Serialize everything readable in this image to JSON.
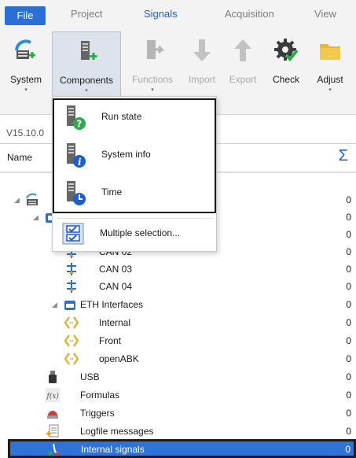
{
  "ribbon_tabs": [
    {
      "label": "File"
    },
    {
      "label": "Project"
    },
    {
      "label": "Signals"
    },
    {
      "label": "Acquisition"
    },
    {
      "label": "View"
    }
  ],
  "ribbon_buttons": [
    {
      "label": "System",
      "icon": "system-icon",
      "enabled": true
    },
    {
      "label": "Components",
      "icon": "components-icon",
      "enabled": true
    },
    {
      "label": "Functions",
      "icon": "functions-icon",
      "enabled": false
    },
    {
      "label": "Import",
      "icon": "import-arrow-icon",
      "enabled": false
    },
    {
      "label": "Export",
      "icon": "export-arrow-icon",
      "enabled": false
    },
    {
      "label": "Check",
      "icon": "check-gear-icon",
      "enabled": true
    },
    {
      "label": "Adjust",
      "icon": "folder-icon",
      "enabled": true
    }
  ],
  "dropdown_marker": "▾",
  "version": "V15.10.0",
  "table_header": {
    "name": "Name",
    "sum_symbol": "Σ"
  },
  "components_menu": {
    "items": [
      {
        "label": "Run state",
        "icon": "run-state-icon"
      },
      {
        "label": "System info",
        "icon": "system-info-icon"
      },
      {
        "label": "Time",
        "icon": "time-icon"
      },
      {
        "label": "Multiple selection...",
        "icon": "multiple-selection-icon"
      }
    ]
  },
  "tree": {
    "rows": [
      {
        "label": "",
        "value": "0",
        "icon": "system-icon"
      },
      {
        "label": "",
        "value": "0",
        "icon": "can-interfaces-icon"
      },
      {
        "label": "",
        "value": "0",
        "icon": "can-icon"
      },
      {
        "label": "CAN 02",
        "value": "0",
        "icon": "can-icon"
      },
      {
        "label": "CAN 03",
        "value": "0",
        "icon": "can-icon"
      },
      {
        "label": "CAN 04",
        "value": "0",
        "icon": "can-icon"
      },
      {
        "label": "ETH Interfaces",
        "value": "0",
        "icon": "eth-interfaces-icon"
      },
      {
        "label": "Internal",
        "value": "0",
        "icon": "eth-port-icon"
      },
      {
        "label": "Front",
        "value": "0",
        "icon": "eth-port-icon"
      },
      {
        "label": "openABK",
        "value": "0",
        "icon": "eth-port-icon"
      },
      {
        "label": "USB",
        "value": "0",
        "icon": "usb-icon"
      },
      {
        "label": "Formulas",
        "value": "0",
        "icon": "formula-icon"
      },
      {
        "label": "Triggers",
        "value": "0",
        "icon": "trigger-icon"
      },
      {
        "label": "Logfile messages",
        "value": "0",
        "icon": "logfile-icon"
      },
      {
        "label": "Internal signals",
        "value": "0",
        "icon": "internal-signals-icon"
      }
    ],
    "expand_glyph": "◢"
  },
  "colors": {
    "accent": "#1c5fc9",
    "file_tab": "#2a6fd6",
    "selection": "#2f73d8",
    "green": "#2fa84f"
  }
}
